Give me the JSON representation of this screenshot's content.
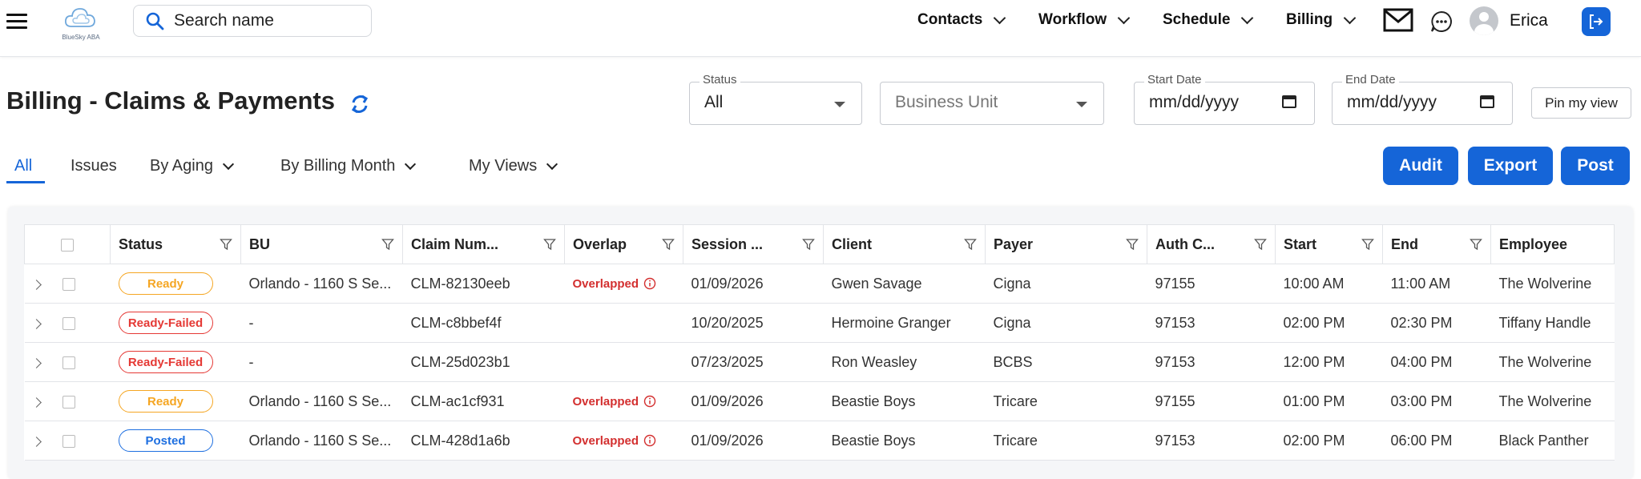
{
  "app": {
    "logo_text": "BlueSky ABA"
  },
  "search": {
    "placeholder": "Search name"
  },
  "nav": [
    {
      "label": "Contacts"
    },
    {
      "label": "Workflow"
    },
    {
      "label": "Schedule"
    },
    {
      "label": "Billing"
    }
  ],
  "user": {
    "name": "Erica"
  },
  "page": {
    "title": "Billing - Claims & Payments"
  },
  "filters": {
    "status": {
      "label": "Status",
      "value": "All"
    },
    "business_unit": {
      "placeholder": "Business Unit"
    },
    "start_date": {
      "label": "Start Date",
      "placeholder": "mm/dd/yyyy"
    },
    "end_date": {
      "label": "End Date",
      "placeholder": "mm/dd/yyyy"
    },
    "pin_label": "Pin my view"
  },
  "tabs": [
    {
      "label": "All",
      "active": true
    },
    {
      "label": "Issues"
    },
    {
      "label": "By Aging"
    },
    {
      "label": "By Billing Month"
    },
    {
      "label": "My Views"
    }
  ],
  "actions": {
    "audit": "Audit",
    "export": "Export",
    "post": "Post"
  },
  "table": {
    "columns": [
      "Status",
      "BU",
      "Claim Num...",
      "Overlap",
      "Session ...",
      "Client",
      "Payer",
      "Auth C...",
      "Start",
      "End",
      "Employee"
    ],
    "rows": [
      {
        "status": "Ready",
        "bu": "Orlando - 1160 S Se...",
        "claim": "CLM-82130eeb",
        "overlap": "Overlapped",
        "session": "01/09/2026",
        "client": "Gwen Savage",
        "payer": "Cigna",
        "auth": "97155",
        "start": "10:00 AM",
        "end": "11:00 AM",
        "employee": "The Wolverine"
      },
      {
        "status": "Ready-Failed",
        "bu": "-",
        "claim": "CLM-c8bbef4f",
        "overlap": "",
        "session": "10/20/2025",
        "client": "Hermoine Granger",
        "payer": "Cigna",
        "auth": "97153",
        "start": "02:00 PM",
        "end": "02:30 PM",
        "employee": "Tiffany Handle"
      },
      {
        "status": "Ready-Failed",
        "bu": "-",
        "claim": "CLM-25d023b1",
        "overlap": "",
        "session": "07/23/2025",
        "client": "Ron Weasley",
        "payer": "BCBS",
        "auth": "97153",
        "start": "12:00 PM",
        "end": "04:00 PM",
        "employee": "The Wolverine"
      },
      {
        "status": "Ready",
        "bu": "Orlando - 1160 S Se...",
        "claim": "CLM-ac1cf931",
        "overlap": "Overlapped",
        "session": "01/09/2026",
        "client": "Beastie Boys",
        "payer": "Tricare",
        "auth": "97155",
        "start": "01:00 PM",
        "end": "03:00 PM",
        "employee": "The Wolverine"
      },
      {
        "status": "Posted",
        "bu": "Orlando - 1160 S Se...",
        "claim": "CLM-428d1a6b",
        "overlap": "Overlapped",
        "session": "01/09/2026",
        "client": "Beastie Boys",
        "payer": "Tricare",
        "auth": "97153",
        "start": "02:00 PM",
        "end": "06:00 PM",
        "employee": "Black Panther"
      }
    ]
  },
  "colors": {
    "accent": "#1565d8",
    "ready": "#f5a623",
    "failed": "#e53935",
    "posted": "#1e6fe0",
    "overlap": "#d32f2f"
  }
}
